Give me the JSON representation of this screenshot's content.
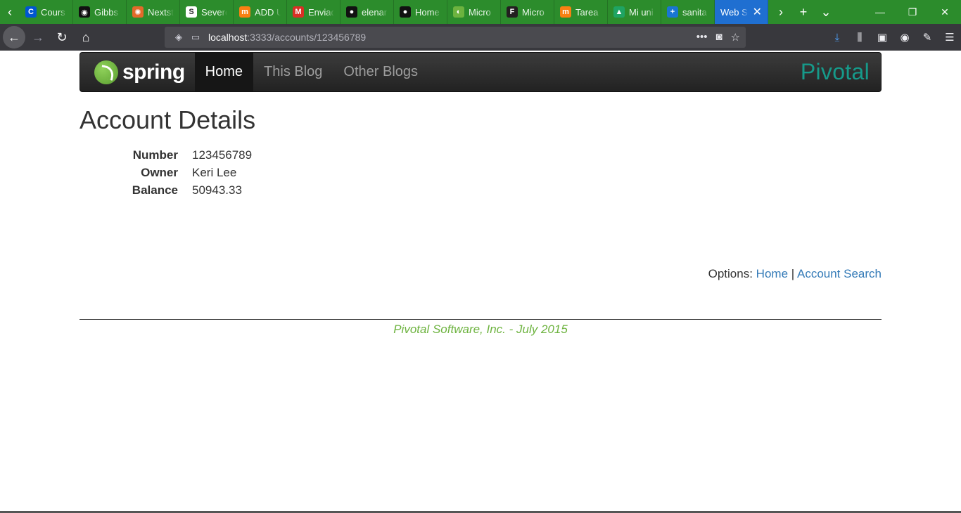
{
  "browser": {
    "tabs": [
      {
        "title": "Cours",
        "favicon": "coursera-icon",
        "color": "#0056d2",
        "glyph": "C"
      },
      {
        "title": "Gibbs",
        "favicon": "gibbs-icon",
        "color": "#111111",
        "glyph": "◉"
      },
      {
        "title": "Nextst",
        "favicon": "nextstrain-icon",
        "color": "#e36a2a",
        "glyph": "✺"
      },
      {
        "title": "Severe",
        "favicon": "document-icon",
        "color": "#ffffff",
        "glyph": "S"
      },
      {
        "title": "ADD U",
        "favicon": "moodle-icon",
        "color": "#f98012",
        "glyph": "m"
      },
      {
        "title": "Enviad",
        "favicon": "gmail-icon",
        "color": "#d93025",
        "glyph": "M"
      },
      {
        "title": "elenar",
        "favicon": "github-icon",
        "color": "#111111",
        "glyph": "●"
      },
      {
        "title": "Home",
        "favicon": "github-icon",
        "color": "#111111",
        "glyph": "●"
      },
      {
        "title": "Micro",
        "favicon": "spring-icon",
        "color": "#6db33f",
        "glyph": "◐"
      },
      {
        "title": "Micro",
        "favicon": "f-icon",
        "color": "#231f20",
        "glyph": "F"
      },
      {
        "title": "Tarea",
        "favicon": "moodle-icon",
        "color": "#f98012",
        "glyph": "m"
      },
      {
        "title": "Mi uni",
        "favicon": "drive-icon",
        "color": "#1fa463",
        "glyph": "▲"
      },
      {
        "title": "sanita",
        "favicon": "app-icon",
        "color": "#1976d2",
        "glyph": "+"
      },
      {
        "title": "Web Se",
        "favicon": "",
        "color": "#1f6fd1",
        "glyph": "",
        "active": true
      }
    ],
    "url_host": "localhost",
    "url_path": ":3333/accounts/123456789"
  },
  "site": {
    "brand": "spring",
    "nav": [
      {
        "label": "Home",
        "active": true
      },
      {
        "label": "This Blog"
      },
      {
        "label": "Other Blogs"
      }
    ],
    "partner": "Pivotal"
  },
  "page": {
    "title": "Account Details",
    "details": [
      {
        "label": "Number",
        "value": "123456789"
      },
      {
        "label": "Owner",
        "value": "Keri Lee"
      },
      {
        "label": "Balance",
        "value": "50943.33"
      }
    ],
    "options": {
      "prefix": "Options:",
      "home": "Home",
      "separator": "|",
      "search": "Account Search"
    },
    "footer": "Pivotal Software, Inc. - July 2015"
  },
  "colors": {
    "tabbar": "#2c8c2c",
    "active_tab": "#1f6fd1",
    "link": "#337ab7",
    "footer": "#6db33f",
    "pivotal": "#169a8a"
  }
}
